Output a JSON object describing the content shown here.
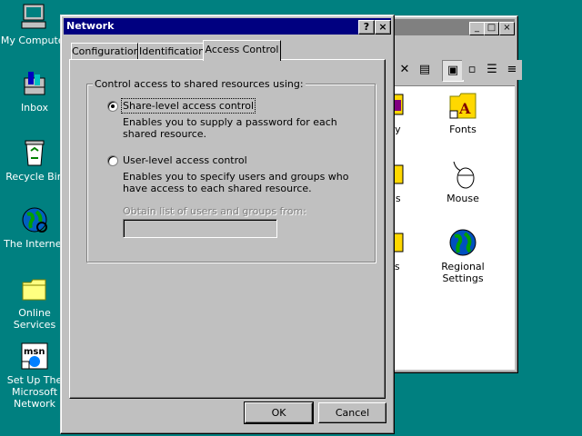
{
  "desktop": {
    "icons": [
      {
        "label": "My Computer"
      },
      {
        "label": "Inbox"
      },
      {
        "label": "Recycle Bin"
      },
      {
        "label": "The Internet"
      },
      {
        "label": "Online Services"
      },
      {
        "label": "Set Up The Microsoft Network"
      }
    ]
  },
  "control_panel": {
    "items": [
      {
        "label": "play"
      },
      {
        "label": "Fonts"
      },
      {
        "label": "ems"
      },
      {
        "label": "Mouse"
      },
      {
        "label": "ters"
      },
      {
        "label": "Regional Settings"
      }
    ],
    "title_buttons": [
      "_",
      "□",
      "×"
    ]
  },
  "dialog": {
    "title": "Network",
    "help_button": "?",
    "close_button": "×",
    "tabs": [
      {
        "label": "Configuration"
      },
      {
        "label": "Identification"
      },
      {
        "label": "Access Control"
      }
    ],
    "group_label": "Control access to shared resources using:",
    "options": [
      {
        "label": "Share-level access control",
        "description": "Enables you to supply a password for each shared resource.",
        "selected": true
      },
      {
        "label": "User-level access control",
        "description": "Enables you to specify users and groups who have access to each shared resource.",
        "selected": false
      }
    ],
    "obtain_label": "Obtain list of users and groups from:",
    "obtain_value": "",
    "ok_label": "OK",
    "cancel_label": "Cancel"
  },
  "colors": {
    "desktop": "#008080",
    "title_active": "#000080",
    "title_inactive": "#808080",
    "face": "#c0c0c0"
  }
}
